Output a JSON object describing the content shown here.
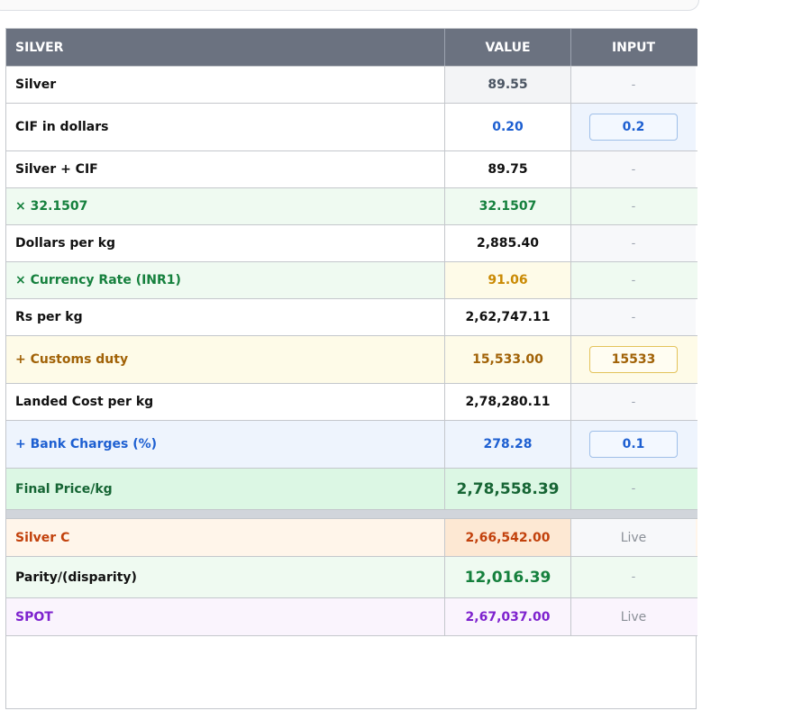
{
  "header": {
    "label": "SILVER",
    "value": "VALUE",
    "input": "INPUT"
  },
  "rows": [
    {
      "label": "Silver",
      "value": "89.55",
      "input": "-"
    },
    {
      "label": "CIF in dollars",
      "value": "0.20",
      "input": "0.2"
    },
    {
      "label": "Silver + CIF",
      "value": "89.75",
      "input": "-"
    },
    {
      "label": "× 32.1507",
      "value": "32.1507",
      "input": "-"
    },
    {
      "label": "Dollars per kg",
      "value": "2,885.40",
      "input": "-"
    },
    {
      "label": "× Currency Rate (INR1)",
      "value": "91.06",
      "input": "-"
    },
    {
      "label": "Rs per kg",
      "value": "2,62,747.11",
      "input": "-"
    },
    {
      "label": "+ Customs duty",
      "value": "15,533.00",
      "input": "15533"
    },
    {
      "label": "Landed Cost per kg",
      "value": "2,78,280.11",
      "input": "-"
    },
    {
      "label": "+ Bank Charges (%)",
      "value": "278.28",
      "input": "0.1"
    },
    {
      "label": "Final Price/kg",
      "value": "2,78,558.39",
      "input": "-"
    }
  ],
  "market_rows": [
    {
      "label": "Silver C",
      "value": "2,66,542.00",
      "input": "Live"
    },
    {
      "label": "Parity/(disparity)",
      "value": "12,016.39",
      "input": "-"
    },
    {
      "label": "SPOT",
      "value": "2,67,037.00",
      "input": "Live"
    }
  ],
  "colors": {
    "header_bg": "#6b7280",
    "blue": "#1d5fd1",
    "green": "#15803d",
    "amber": "#ca8a04",
    "brown": "#a16207",
    "orange": "#c2410c",
    "purple": "#7e22ce"
  }
}
